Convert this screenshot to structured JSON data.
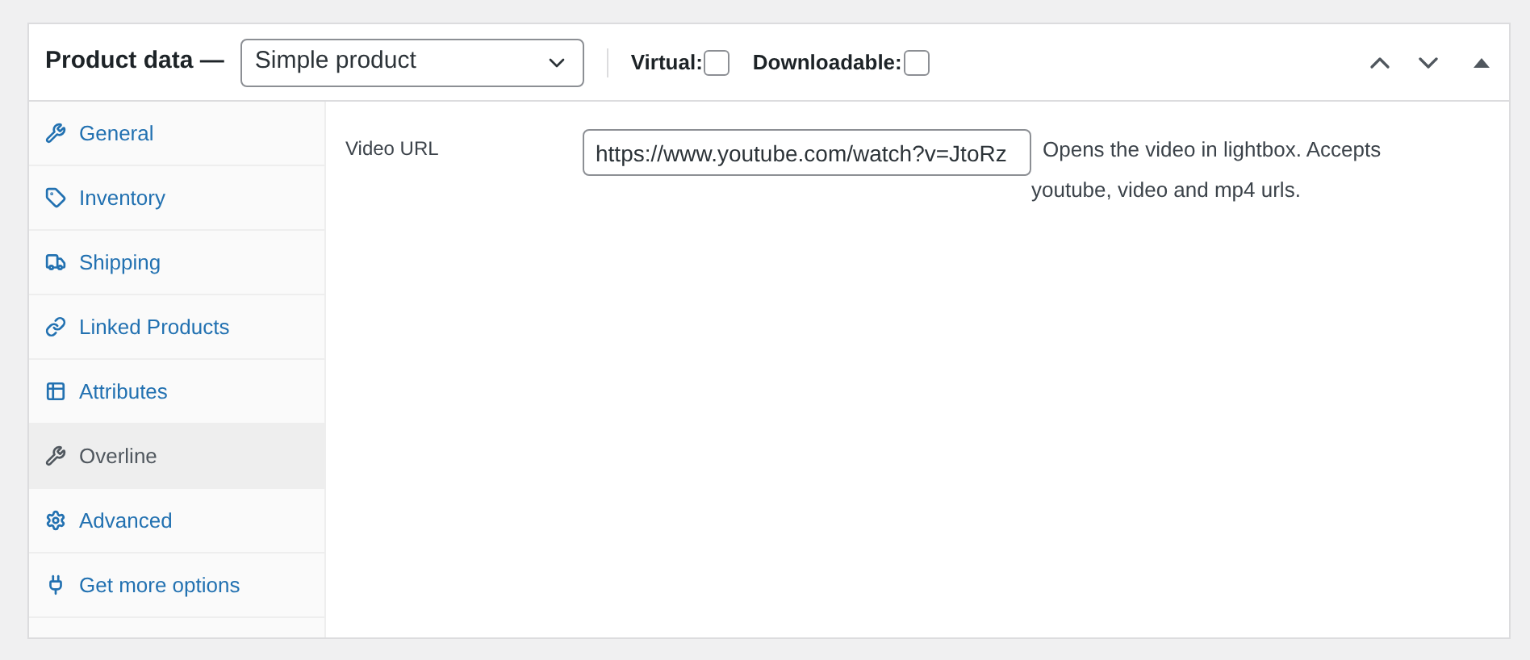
{
  "header": {
    "title": "Product data —",
    "product_type": "Simple product",
    "options": [
      {
        "label": "Virtual:",
        "checked": false
      },
      {
        "label": "Downloadable:",
        "checked": false
      }
    ]
  },
  "tabs": [
    {
      "label": "General",
      "selected": false
    },
    {
      "label": "Inventory",
      "selected": false
    },
    {
      "label": "Shipping",
      "selected": false
    },
    {
      "label": "Linked Products",
      "selected": false
    },
    {
      "label": "Attributes",
      "selected": false
    },
    {
      "label": "Overline",
      "selected": true
    },
    {
      "label": "Advanced",
      "selected": false
    },
    {
      "label": "Get more options",
      "selected": false
    }
  ],
  "field": {
    "label": "Video URL",
    "value": "https://www.youtube.com/watch?v=JtoRz",
    "help": "Opens the video in lightbox. Accepts youtube, video and mp4 urls."
  }
}
